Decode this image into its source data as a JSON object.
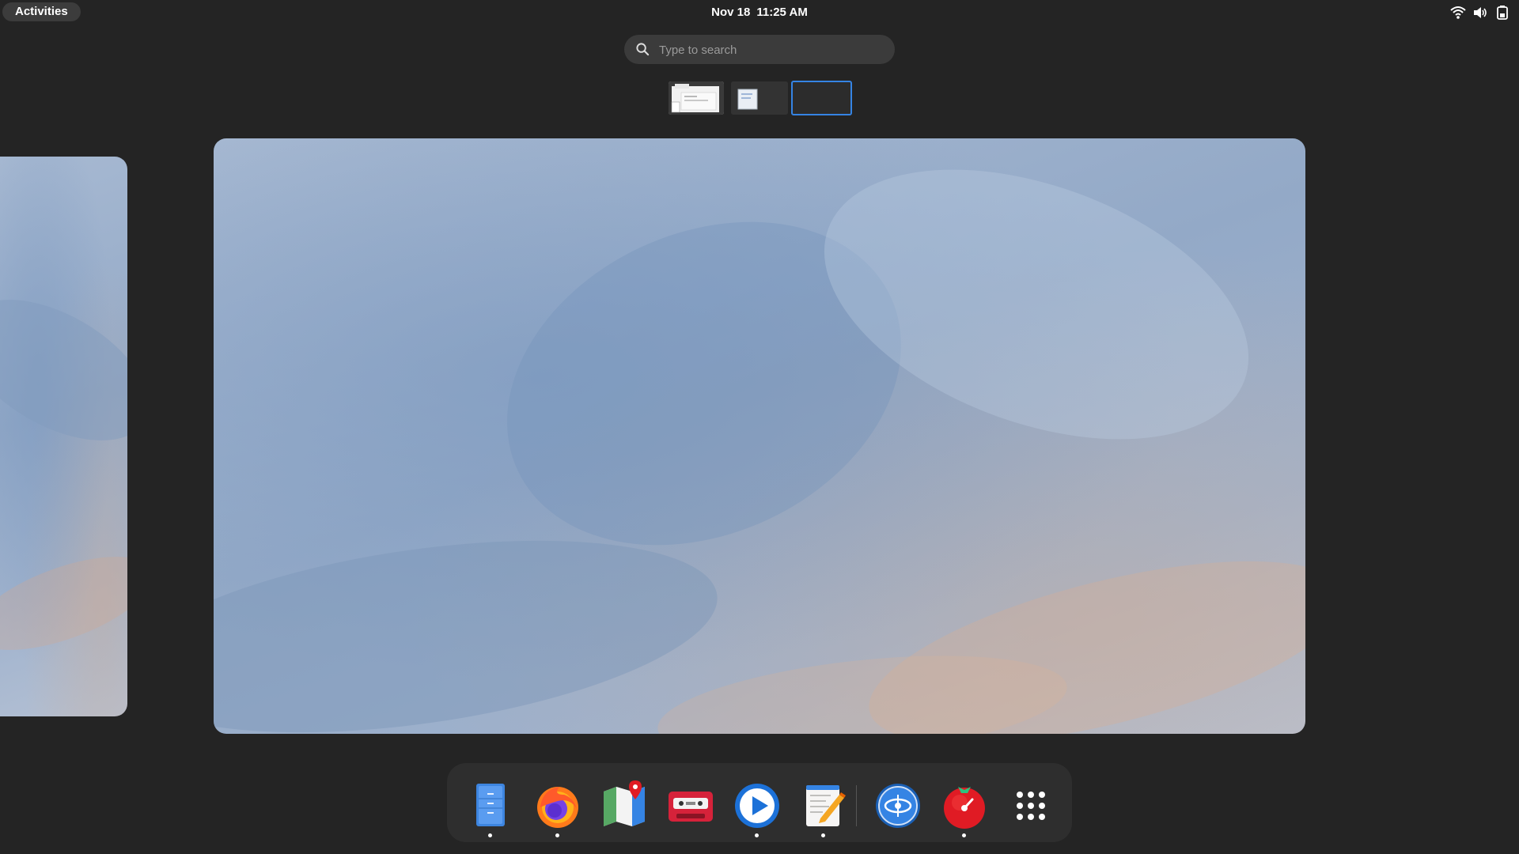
{
  "topbar": {
    "activities_label": "Activities",
    "date": "Nov 18",
    "time": "11:25 AM",
    "tray_icons": [
      "wifi-icon",
      "volume-icon",
      "battery-icon"
    ]
  },
  "search": {
    "placeholder": "Type to search"
  },
  "workspaces": {
    "thumbnails": [
      "workspace-1",
      "workspace-2",
      "workspace-3"
    ],
    "active_index": 2,
    "accent": "#3584e4"
  },
  "dash": {
    "apps": [
      {
        "name": "Files",
        "icon": "files-icon",
        "running": true
      },
      {
        "name": "Firefox",
        "icon": "firefox-icon",
        "running": true
      },
      {
        "name": "Maps",
        "icon": "maps-icon",
        "running": false
      },
      {
        "name": "Tape Recorder",
        "icon": "cassette-icon",
        "running": false
      },
      {
        "name": "Media Player",
        "icon": "play-icon",
        "running": true
      },
      {
        "name": "Text Editor",
        "icon": "text-editor-icon",
        "running": true
      },
      {
        "name": "Remote Desktop",
        "icon": "remote-icon",
        "running": false
      },
      {
        "name": "Pomodoro",
        "icon": "tomato-icon",
        "running": true
      },
      {
        "name": "Show Applications",
        "icon": "app-grid-icon",
        "running": false
      }
    ]
  }
}
